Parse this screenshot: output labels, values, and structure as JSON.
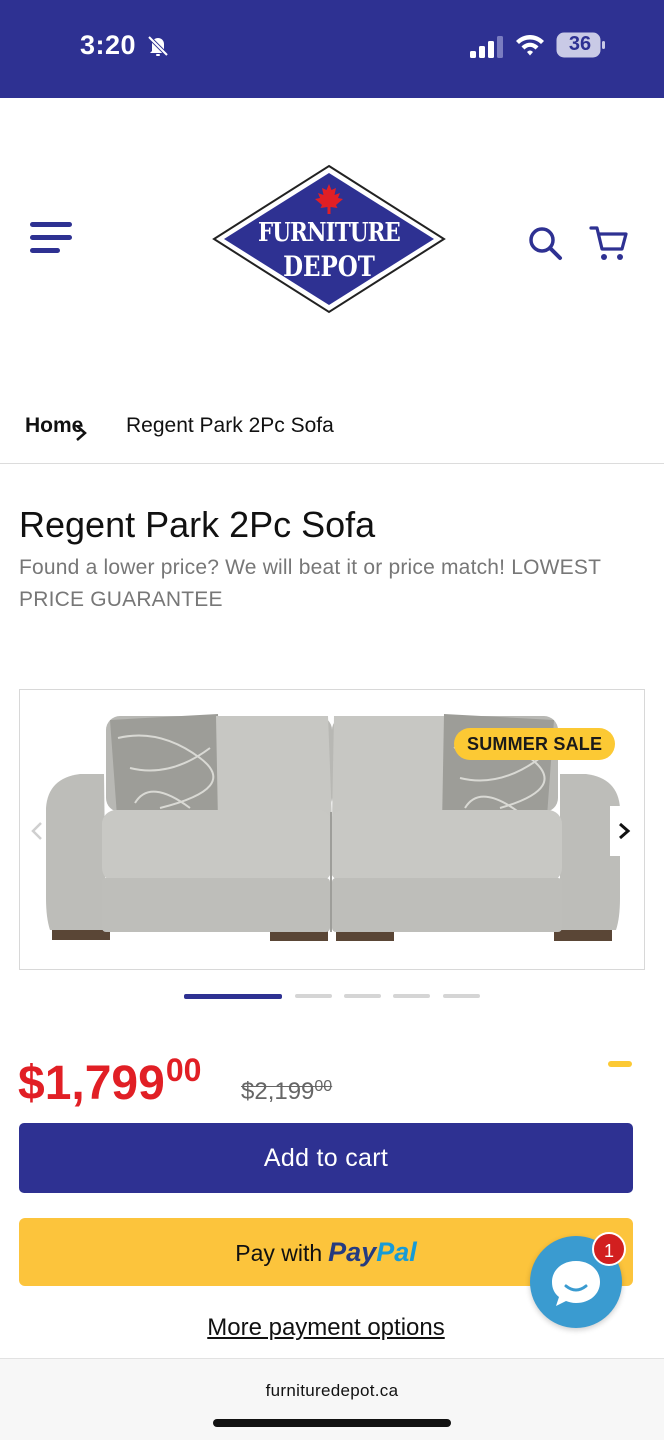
{
  "status_bar": {
    "time": "3:20",
    "battery": "36",
    "icons": [
      "bell-slash-icon",
      "signal-icon",
      "wifi-icon",
      "battery-icon"
    ]
  },
  "header": {
    "logo_line1": "FURNITURE",
    "logo_line2": "DEPOT",
    "icons": [
      "hamburger-menu-icon",
      "search-icon",
      "cart-icon"
    ],
    "brand_color": "#2e3192",
    "maple_leaf_color": "#e11f25"
  },
  "breadcrumb": {
    "home": "Home",
    "current": "Regent Park 2Pc Sofa"
  },
  "product": {
    "title": "Regent Park 2Pc Sofa",
    "subtitle": "Found a lower price? We will beat it or price match! LOWEST PRICE GUARANTEE",
    "badge": "SUMMER SALE",
    "price_main": "$1,799",
    "price_cents": "00",
    "old_price_main": "$2,199",
    "old_price_cents": "00",
    "price_color": "#e11f25",
    "badge_color": "#fcc934"
  },
  "gallery": {
    "slide_count": 5,
    "active_slide": 1
  },
  "actions": {
    "add_to_cart": "Add to cart",
    "pay_with": "Pay with",
    "paypal_pay": "Pay",
    "paypal_pal": "Pal",
    "more_payment": "More payment options"
  },
  "chat": {
    "unread": "1"
  },
  "browser": {
    "url": "furnituredepot.ca"
  }
}
